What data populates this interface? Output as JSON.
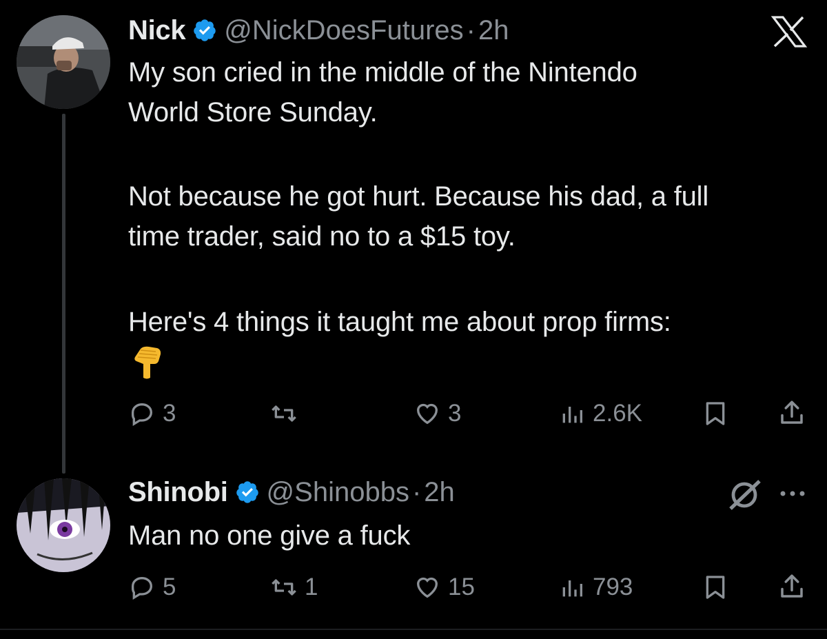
{
  "tweet": {
    "name": "Nick",
    "handle": "@NickDoesFutures",
    "separator": "·",
    "time": "2h",
    "lines": [
      "My son cried in the middle of the Nintendo",
      "World Store Sunday.",
      "Not because he got hurt. Because his dad, a full",
      "time trader, said no to a $15 toy.",
      "Here's 4 things it taught me about prop firms:"
    ],
    "emoji": "👇",
    "actions": {
      "replies": "3",
      "retweets": "",
      "likes": "3",
      "views": "2.6K"
    },
    "icons": [
      "x-logo-icon",
      "reply-icon",
      "retweet-icon",
      "like-icon",
      "views-icon",
      "bookmark-icon",
      "share-icon"
    ]
  },
  "reply": {
    "name": "Shinobi",
    "handle": "@Shinobbs",
    "separator": "·",
    "time": "2h",
    "text": "Man no one give a fuck",
    "actions": {
      "replies": "5",
      "retweets": "1",
      "likes": "15",
      "views": "793"
    },
    "icons": [
      "grok-icon",
      "more-icon",
      "reply-icon",
      "retweet-icon",
      "like-icon",
      "views-icon",
      "bookmark-icon",
      "share-icon"
    ]
  },
  "colors": {
    "background": "#000000",
    "text": "#e7e9ea",
    "secondary": "#8b9096",
    "verified": "#1d9bf0"
  }
}
